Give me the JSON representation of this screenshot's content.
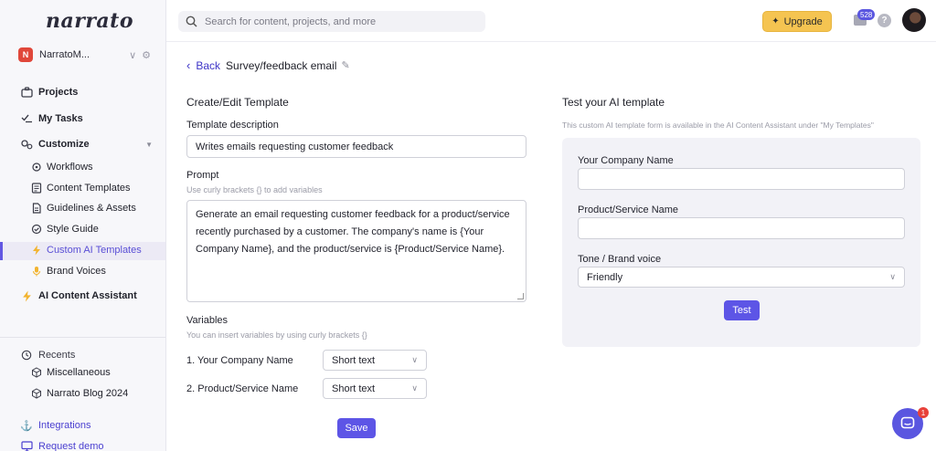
{
  "app": {
    "logo": "narrato"
  },
  "workspace": {
    "badge": "N",
    "name": "NarratoM..."
  },
  "sidebar": {
    "projects": "Projects",
    "my_tasks": "My Tasks",
    "customize": "Customize",
    "sub": [
      "Workflows",
      "Content Templates",
      "Guidelines & Assets",
      "Style Guide",
      "Custom AI Templates",
      "Brand Voices"
    ],
    "ai_assistant": "AI Content Assistant",
    "recents": "Recents",
    "recent_items": [
      "Miscellaneous",
      "Narrato Blog 2024"
    ],
    "integrations": "Integrations",
    "request_demo": "Request demo"
  },
  "topbar": {
    "search_placeholder": "Search for content, projects, and more",
    "upgrade": "Upgrade",
    "messages_count": "528",
    "help": "?"
  },
  "page": {
    "back": "Back",
    "title": "Survey/feedback email"
  },
  "form": {
    "heading": "Create/Edit Template",
    "desc_label": "Template description",
    "desc_value": "Writes emails requesting customer feedback",
    "prompt_label": "Prompt",
    "prompt_hint": "Use curly brackets {} to add variables",
    "prompt_lines": [
      "Generate an email requesting customer feedback for a product/service",
      "recently purchased by a customer. The company's name is {Your",
      "Company Name}, and the product/service is {Product/Service Name}."
    ],
    "vars_label": "Variables",
    "vars_hint": "You can insert variables by using curly brackets {}",
    "variables": [
      {
        "name": "1. Your Company Name",
        "type": "Short text"
      },
      {
        "name": "2. Product/Service Name",
        "type": "Short text"
      }
    ],
    "save": "Save"
  },
  "test": {
    "heading": "Test your AI template",
    "hint": "This custom AI template form is available in the AI Content Assistant under \"My Templates\"",
    "company_label": "Your Company Name",
    "product_label": "Product/Service Name",
    "tone_label": "Tone / Brand voice",
    "tone_value": "Friendly",
    "test_button": "Test"
  },
  "chat": {
    "badge": "1"
  },
  "colors": {
    "accent": "#5d55e6",
    "upgrade": "#f5c451",
    "badge_red": "#e8413a"
  }
}
